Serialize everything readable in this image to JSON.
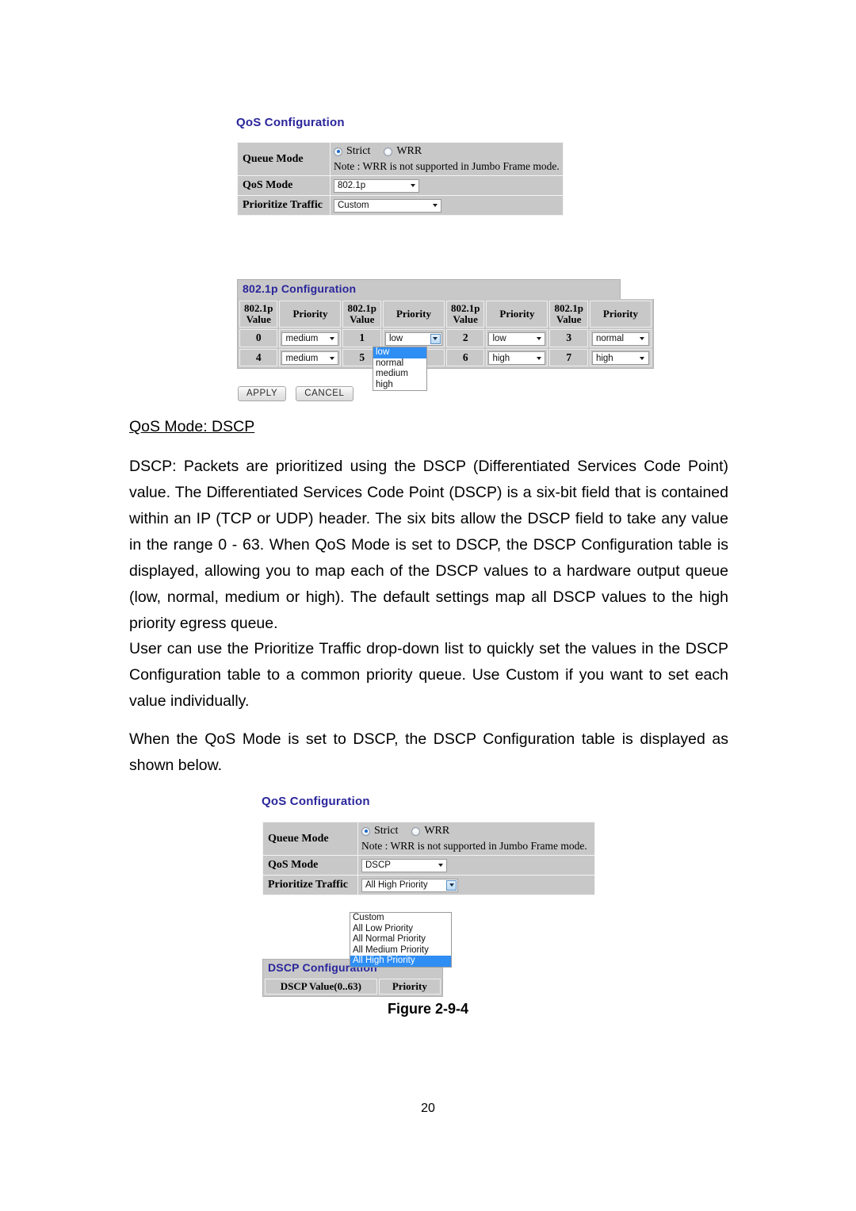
{
  "document": {
    "page_number": "20",
    "figure_caption": "Figure 2-9-4",
    "heading": "QoS Mode: DSCP",
    "paragraph1": "DSCP: Packets are prioritized using the DSCP (Differentiated Services Code Point) value. The Differentiated Services Code Point (DSCP) is a six-bit field that is contained within an IP (TCP or UDP) header. The six bits allow the DSCP field to take any value in the range 0 - 63. When QoS Mode is set to DSCP, the DSCP Configuration table is displayed, allowing you to map each of the DSCP values to a hardware output queue (low, normal, medium or high). The default settings map all DSCP values to the high priority egress queue.",
    "paragraph2": "User can use the Prioritize Traffic drop-down list to quickly set the values in the DSCP Configuration table to a common priority queue. Use Custom if you want to set each value individually.",
    "paragraph3": "When the QoS Mode is set to DSCP, the DSCP Configuration table is displayed as shown below."
  },
  "screenshot_top": {
    "panel_title": "QoS Configuration",
    "queue_mode": {
      "label": "Queue Mode",
      "option_strict": "Strict",
      "option_wrr": "WRR",
      "selected": "Strict",
      "note": "Note : WRR is not supported in Jumbo Frame mode."
    },
    "qos_mode": {
      "label": "QoS Mode",
      "value": "802.1p"
    },
    "prioritize_traffic": {
      "label": "Prioritize Traffic",
      "value": "Custom"
    },
    "dot1p_panel": {
      "title": "802.1p Configuration",
      "header_value": "802.1p\nValue",
      "header_value_line1": "802.1p",
      "header_value_line2": "Value",
      "header_priority": "Priority",
      "rows": [
        [
          {
            "value": "0",
            "priority": "medium"
          },
          {
            "value": "1",
            "priority": "low"
          },
          {
            "value": "2",
            "priority": "low"
          },
          {
            "value": "3",
            "priority": "normal"
          }
        ],
        [
          {
            "value": "4",
            "priority": "medium"
          },
          {
            "value": "5",
            "priority": ""
          },
          {
            "value": "6",
            "priority": "high"
          },
          {
            "value": "7",
            "priority": "high"
          }
        ]
      ],
      "open_dropdown": {
        "options": [
          "low",
          "normal",
          "medium",
          "high"
        ],
        "selected": "low"
      },
      "apply_button": "APPLY",
      "cancel_button": "CANCEL"
    }
  },
  "screenshot_bottom": {
    "panel_title": "QoS Configuration",
    "queue_mode": {
      "label": "Queue Mode",
      "option_strict": "Strict",
      "option_wrr": "WRR",
      "selected": "Strict",
      "note": "Note : WRR is not supported in Jumbo Frame mode."
    },
    "qos_mode": {
      "label": "QoS Mode",
      "value": "DSCP"
    },
    "prioritize_traffic": {
      "label": "Prioritize Traffic",
      "value": "All High Priority",
      "open_dropdown": {
        "options": [
          "Custom",
          "All Low Priority",
          "All Normal Priority",
          "All Medium Priority",
          "All High Priority"
        ],
        "selected": "All High Priority"
      }
    },
    "dscp_panel": {
      "title": "DSCP Configuration",
      "header_value": "DSCP Value(0..63)",
      "header_priority": "Priority"
    }
  }
}
